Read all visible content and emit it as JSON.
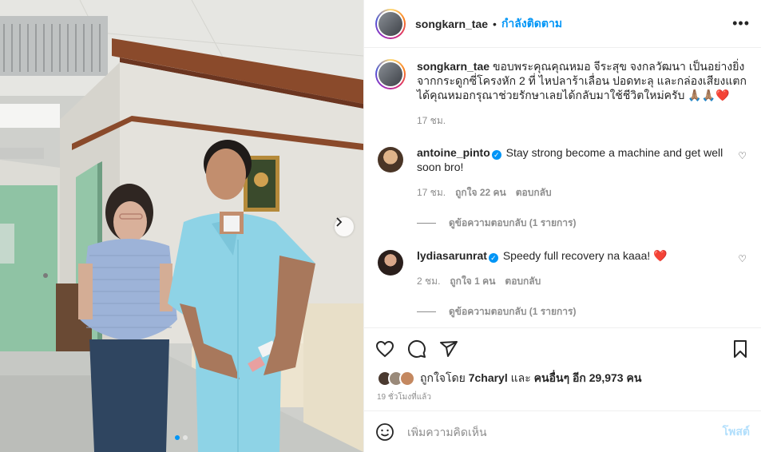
{
  "header": {
    "username": "songkarn_tae",
    "separator": "•",
    "follow_label": "กำลังติดตาม",
    "more_label": "•••"
  },
  "caption": {
    "username": "songkarn_tae",
    "text": "ขอบพระคุณคุณหมอ จีระสุข จงกลวัฒนา เป็นอย่างยิ่ง จากกระดูกซี่โครงหัก 2 ที่ ไหปลาร้าเลื่อน ปอดทะลุ และกล่องเสียงแตก ได้คุณหมอกรุณาช่วยรักษาเลยได้กลับมาใช้ชีวิตใหม่ครับ 🙏🏽🙏🏽❤️",
    "time": "17 ชม."
  },
  "comments": [
    {
      "username": "antoine_pinto",
      "text": "Stay strong become a machine and get well soon bro!",
      "time": "17 ชม.",
      "likes": "ถูกใจ 22 คน",
      "reply_label": "ตอบกลับ",
      "view_replies": "ดูข้อความตอบกลับ (1 รายการ)",
      "avatar_color": "#c9925e"
    },
    {
      "username": "lydiasarunrat",
      "text": "Speedy full recovery na kaaa! ❤️",
      "time": "2 ชม.",
      "likes": "ถูกใจ 1 คน",
      "reply_label": "ตอบกลับ",
      "view_replies": "ดูข้อความตอบกลับ (1 รายการ)",
      "avatar_color": "#6b4a3a"
    }
  ],
  "likes": {
    "prefix": "ถูกใจโดย",
    "user": "7charyl",
    "and": "และ",
    "others": "คนอื่นๆ อีก 29,973 คน"
  },
  "post_time": "19 ชั่วโมงที่แล้ว",
  "add_comment": {
    "placeholder": "เพิ่มความคิดเห็น",
    "post_label": "โพสต์"
  },
  "colors": {
    "accent": "#0095f6",
    "heart": "#ed4956",
    "muted": "#8e8e8e"
  },
  "carousel": {
    "slide_count": 2,
    "active_slide": 1
  }
}
